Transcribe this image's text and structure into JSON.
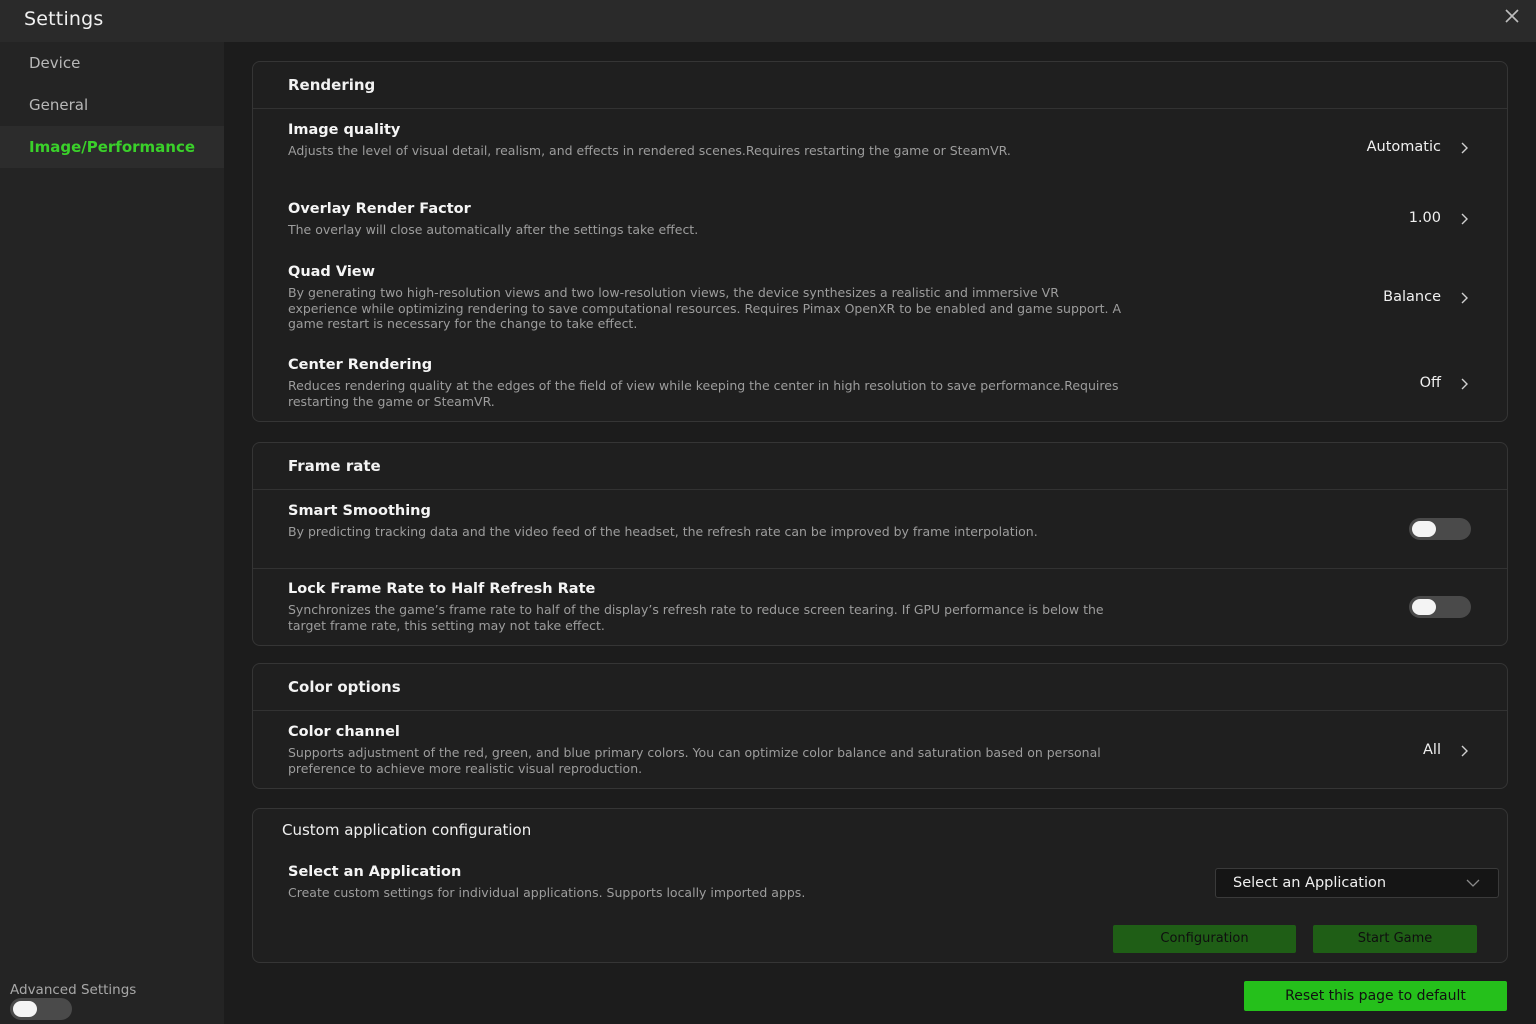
{
  "window": {
    "title": "Settings"
  },
  "sidebar": {
    "items": [
      {
        "label": "Device"
      },
      {
        "label": "General"
      },
      {
        "label": "Image/Performance"
      }
    ],
    "advanced_label": "Advanced Settings"
  },
  "rendering": {
    "header": "Rendering",
    "rows": [
      {
        "title": "Image quality",
        "desc": "Adjusts the level of visual detail, realism, and effects in rendered scenes.Requires restarting the game or SteamVR.",
        "value": "Automatic"
      },
      {
        "title": "Overlay Render Factor",
        "desc": "The overlay will close automatically after the settings take effect.",
        "value": "1.00"
      },
      {
        "title": "Quad View",
        "desc": "By generating two high-resolution views and two low-resolution views, the device synthesizes a realistic and immersive VR experience while optimizing rendering to save computational resources. Requires Pimax OpenXR to be enabled and game support. A game restart is necessary for the change to take effect.",
        "value": "Balance"
      },
      {
        "title": "Center Rendering",
        "desc": "Reduces rendering quality at the edges of the field of view while keeping the center in high resolution to save performance.Requires restarting the game or SteamVR.",
        "value": "Off"
      }
    ]
  },
  "frame_rate": {
    "header": "Frame rate",
    "rows": [
      {
        "title": "Smart Smoothing",
        "desc": "By predicting tracking data and the video feed of the headset, the refresh rate can be improved by frame interpolation."
      },
      {
        "title": "Lock Frame Rate to Half Refresh Rate",
        "desc": "Synchronizes the game’s frame rate to half of the display’s refresh rate to reduce screen tearing. If GPU performance is below the target frame rate, this setting may not take effect."
      }
    ]
  },
  "color": {
    "header": "Color options",
    "rows": [
      {
        "title": "Color channel",
        "desc": "Supports adjustment of the red, green, and blue primary colors. You can optimize color balance and saturation based on personal preference to achieve more realistic visual reproduction.",
        "value": "All"
      }
    ]
  },
  "custom": {
    "header": "Custom application configuration",
    "title": "Select an Application",
    "desc": "Create custom settings for individual applications. Supports locally imported apps.",
    "select_value": "Select an Application",
    "config_button": "Configuration",
    "start_button": "Start Game"
  },
  "footer": {
    "reset_button": "Reset this page to default"
  },
  "colors": {
    "accent": "#3ad12a",
    "button_green": "#25c01b",
    "button_dark_green": "#1f5e16",
    "background": "#1c1c1c"
  }
}
